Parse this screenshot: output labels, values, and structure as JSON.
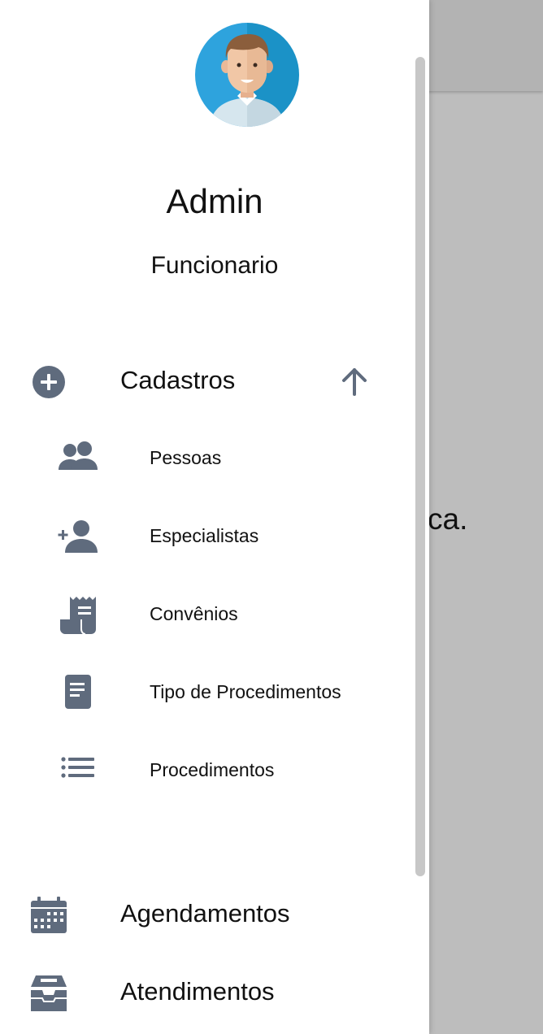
{
  "user": {
    "name": "Admin",
    "role": "Funcionario",
    "avatar_icon": "user-avatar"
  },
  "menu": {
    "section": {
      "label": "Cadastros",
      "icon": "add-circle-icon",
      "toggle_icon": "arrow-up-icon",
      "expanded": true,
      "items": [
        {
          "label": "Pessoas",
          "icon": "people-icon"
        },
        {
          "label": "Especialistas",
          "icon": "person-add-icon"
        },
        {
          "label": "Convênios",
          "icon": "receipt-icon"
        },
        {
          "label": "Tipo de Procedimentos",
          "icon": "document-icon"
        },
        {
          "label": "Procedimentos",
          "icon": "list-icon"
        }
      ]
    },
    "items": [
      {
        "label": "Agendamentos",
        "icon": "calendar-icon"
      },
      {
        "label": "Atendimentos",
        "icon": "inbox-icon"
      }
    ]
  },
  "background": {
    "partial_text": "ca."
  },
  "colors": {
    "icon": "#5f6b7d",
    "text": "#111111",
    "overlay": "#bdbdbd",
    "avatar_bg": "#2ea3dd"
  }
}
